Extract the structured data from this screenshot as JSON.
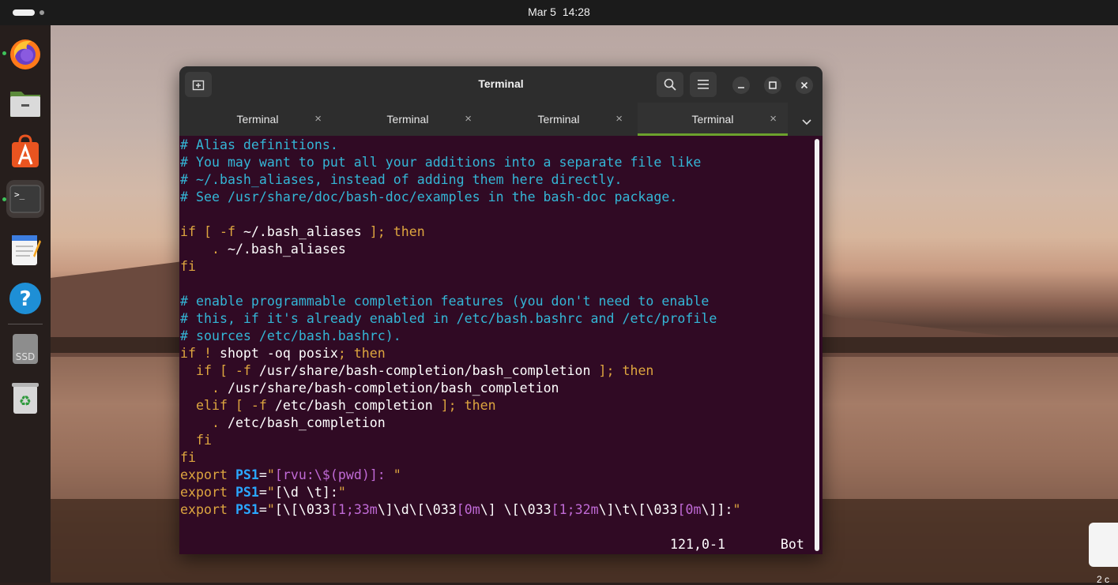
{
  "topbar": {
    "date": "Mar 5",
    "time": "14:28"
  },
  "dock": {
    "items": [
      {
        "name": "firefox-icon"
      },
      {
        "name": "files-icon"
      },
      {
        "name": "app-center-icon"
      },
      {
        "name": "terminal-icon"
      },
      {
        "name": "text-editor-icon"
      },
      {
        "name": "help-icon"
      },
      {
        "name": "ssd-drive-icon",
        "label": "SSD"
      },
      {
        "name": "trash-icon"
      }
    ]
  },
  "window": {
    "title": "Terminal",
    "tabs": [
      {
        "label": "Terminal",
        "active": false
      },
      {
        "label": "Terminal",
        "active": false
      },
      {
        "label": "Terminal",
        "active": false
      },
      {
        "label": "Terminal",
        "active": true
      }
    ],
    "tab_close_glyph": "×"
  },
  "terminal": {
    "lines": [
      [
        {
          "t": "# Alias definitions.",
          "c": "c"
        }
      ],
      [
        {
          "t": "# You may want to put all your additions into a separate file like",
          "c": "c"
        }
      ],
      [
        {
          "t": "# ~/.bash_aliases, instead of adding them here directly.",
          "c": "c"
        }
      ],
      [
        {
          "t": "# See /usr/share/doc/bash-doc/examples in the bash-doc package.",
          "c": "c"
        }
      ],
      [
        {
          "t": "",
          "c": "w"
        }
      ],
      [
        {
          "t": "if [ -f ",
          "c": "k"
        },
        {
          "t": "~/.bash_aliases",
          "c": "w"
        },
        {
          "t": " ]; then",
          "c": "k"
        }
      ],
      [
        {
          "t": "    . ",
          "c": "k"
        },
        {
          "t": "~/.bash_aliases",
          "c": "w"
        }
      ],
      [
        {
          "t": "fi",
          "c": "k"
        }
      ],
      [
        {
          "t": "",
          "c": "w"
        }
      ],
      [
        {
          "t": "# enable programmable completion features (you don't need to enable",
          "c": "c"
        }
      ],
      [
        {
          "t": "# this, if it's already enabled in /etc/bash.bashrc and /etc/profile",
          "c": "c"
        }
      ],
      [
        {
          "t": "# sources /etc/bash.bashrc).",
          "c": "c"
        }
      ],
      [
        {
          "t": "if ! ",
          "c": "k"
        },
        {
          "t": "shopt -oq posix",
          "c": "w"
        },
        {
          "t": "; then",
          "c": "k"
        }
      ],
      [
        {
          "t": "  if [ -f ",
          "c": "k"
        },
        {
          "t": "/usr/share/bash-completion/bash_completion",
          "c": "w"
        },
        {
          "t": " ]; then",
          "c": "k"
        }
      ],
      [
        {
          "t": "    . ",
          "c": "k"
        },
        {
          "t": "/usr/share/bash-completion/bash_completion",
          "c": "w"
        }
      ],
      [
        {
          "t": "  elif [ -f ",
          "c": "k"
        },
        {
          "t": "/etc/bash_completion",
          "c": "w"
        },
        {
          "t": " ]; then",
          "c": "k"
        }
      ],
      [
        {
          "t": "    . ",
          "c": "k"
        },
        {
          "t": "/etc/bash_completion",
          "c": "w"
        }
      ],
      [
        {
          "t": "  fi",
          "c": "k"
        }
      ],
      [
        {
          "t": "fi",
          "c": "k"
        }
      ],
      [
        {
          "t": "export ",
          "c": "k"
        },
        {
          "t": "PS1",
          "c": "p"
        },
        {
          "t": "=",
          "c": "w"
        },
        {
          "t": "\"",
          "c": "k"
        },
        {
          "t": "[rvu:\\$",
          "c": "s"
        },
        {
          "t": "(pwd)",
          "c": "s"
        },
        {
          "t": "]: ",
          "c": "s"
        },
        {
          "t": "\"",
          "c": "k"
        }
      ],
      [
        {
          "t": "export ",
          "c": "k"
        },
        {
          "t": "PS1",
          "c": "p"
        },
        {
          "t": "=",
          "c": "w"
        },
        {
          "t": "\"",
          "c": "k"
        },
        {
          "t": "[\\d \\t]:",
          "c": "w"
        },
        {
          "t": "\"",
          "c": "k"
        }
      ],
      [
        {
          "t": "export ",
          "c": "k"
        },
        {
          "t": "PS1",
          "c": "p"
        },
        {
          "t": "=",
          "c": "w"
        },
        {
          "t": "\"",
          "c": "k"
        },
        {
          "t": "[\\[\\033",
          "c": "w"
        },
        {
          "t": "[1;33m",
          "c": "s"
        },
        {
          "t": "\\]\\d\\[\\033",
          "c": "w"
        },
        {
          "t": "[0m",
          "c": "s"
        },
        {
          "t": "\\] \\[\\033",
          "c": "w"
        },
        {
          "t": "[1;32m",
          "c": "s"
        },
        {
          "t": "\\]\\t\\[\\033",
          "c": "w"
        },
        {
          "t": "[0m",
          "c": "s"
        },
        {
          "t": "\\]]:",
          "c": "w"
        },
        {
          "t": "\"",
          "c": "k"
        }
      ]
    ],
    "status_position": "121,0-1",
    "status_scroll": "Bot"
  },
  "desktop": {
    "file_label": "2 c"
  },
  "colors": {
    "terminal_bg": "#300a24",
    "comment": "#34b6d6",
    "keyword": "#dda53f",
    "variable": "#2aa7ff",
    "string": "#c06ad6",
    "tab_active_underline": "#6ca12d"
  }
}
